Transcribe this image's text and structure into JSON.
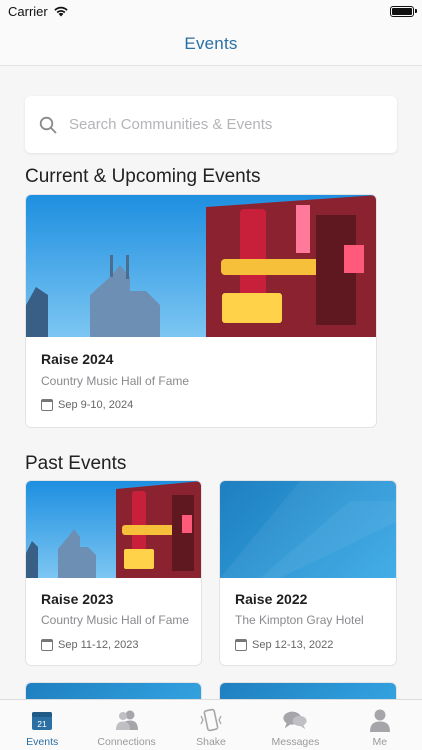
{
  "status_bar": {
    "carrier": "Carrier"
  },
  "nav": {
    "title": "Events"
  },
  "search": {
    "placeholder": "Search Communities & Events"
  },
  "sections": {
    "current": "Current & Upcoming Events",
    "past": "Past Events"
  },
  "current_event": {
    "title": "Raise 2024",
    "venue": "Country Music Hall of Fame",
    "date": "Sep 9-10, 2024"
  },
  "past_events": [
    {
      "title": "Raise 2023",
      "venue": "Country Music Hall of Fame",
      "date": "Sep 11-12, 2023"
    },
    {
      "title": "Raise 2022",
      "venue": "The Kimpton Gray Hotel",
      "date": "Sep 12-13, 2022"
    }
  ],
  "tabs": [
    {
      "label": "Events",
      "icon": "calendar-icon",
      "badge": "21",
      "active": true
    },
    {
      "label": "Connections",
      "icon": "people-icon"
    },
    {
      "label": "Shake",
      "icon": "phone-shake-icon"
    },
    {
      "label": "Messages",
      "icon": "chat-bubbles-icon"
    },
    {
      "label": "Me",
      "icon": "person-icon"
    }
  ],
  "colors": {
    "accent": "#2c6fa3",
    "background": "#f6f6f7",
    "card": "#ffffff"
  }
}
